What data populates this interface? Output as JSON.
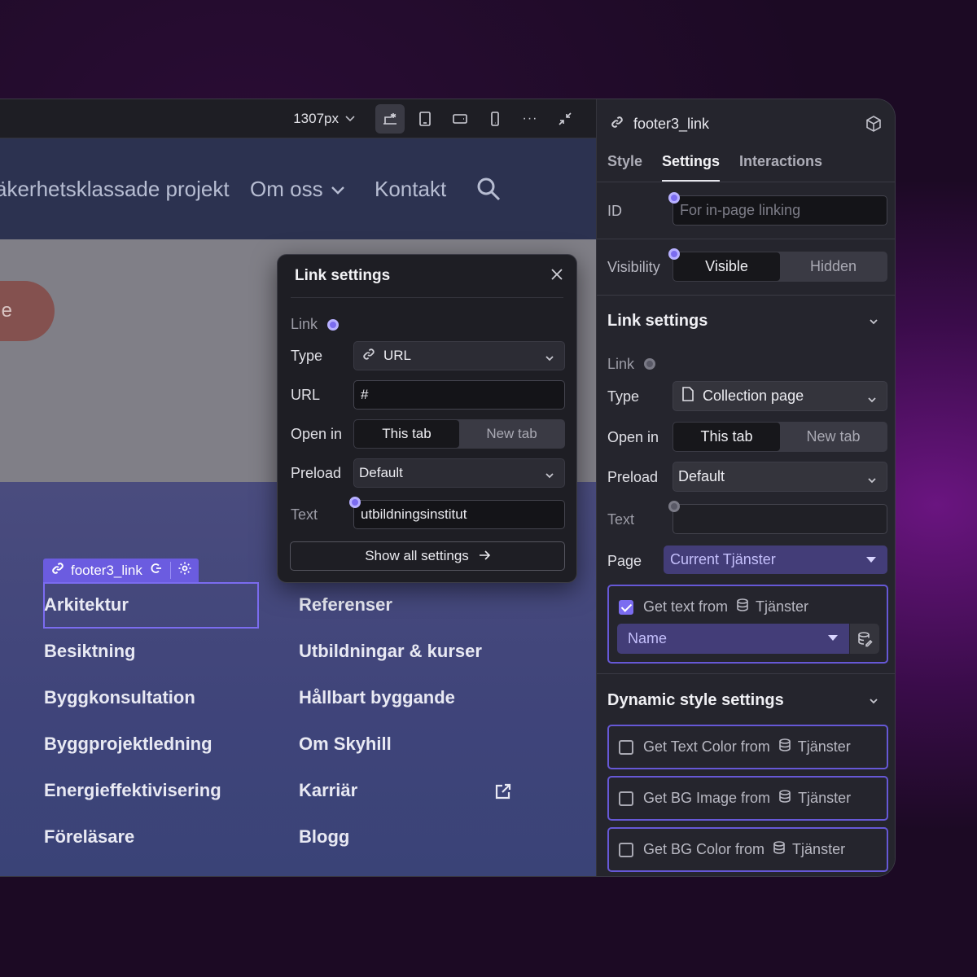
{
  "toolbar": {
    "width_label": "1307px",
    "more_label": "···"
  },
  "site": {
    "nav": [
      "äkerhetsklassade projekt",
      "Om oss",
      "Kontakt"
    ],
    "hero_button": "e",
    "footer_col1": [
      "Arkitektur",
      "Besiktning",
      "Byggkonsultation",
      "Byggprojektledning",
      "Energieffektivisering",
      "Föreläsare"
    ],
    "footer_col2": [
      "Referenser",
      "Utbildningar & kurser",
      "Hållbart byggande",
      "Om Skyhill",
      "Karriär",
      "Blogg"
    ],
    "selected_tag": "footer3_link"
  },
  "popup": {
    "title": "Link settings",
    "link_label": "Link",
    "type_label": "Type",
    "type_value": "URL",
    "url_label": "URL",
    "url_value": "#",
    "open_in_label": "Open in",
    "open_this": "This tab",
    "open_new": "New tab",
    "preload_label": "Preload",
    "preload_value": "Default",
    "text_label": "Text",
    "text_value": "utbildningsinstitut",
    "show_all": "Show all settings"
  },
  "panel": {
    "element_name": "footer3_link",
    "tabs": [
      "Style",
      "Settings",
      "Interactions"
    ],
    "active_tab": "Settings",
    "id_label": "ID",
    "id_placeholder": "For in-page linking",
    "visibility_label": "Visibility",
    "visible": "Visible",
    "hidden": "Hidden",
    "link_settings_title": "Link settings",
    "link_label": "Link",
    "type_label": "Type",
    "type_value": "Collection page",
    "open_in_label": "Open in",
    "open_this": "This tab",
    "open_new": "New tab",
    "preload_label": "Preload",
    "preload_value": "Default",
    "text_label": "Text",
    "page_label": "Page",
    "page_value": "Current Tjänster",
    "get_text_from": "Get text from",
    "collection": "Tjänster",
    "name_field": "Name",
    "dynamic_title": "Dynamic style settings",
    "dynamic_items": [
      "Get Text Color from",
      "Get BG Image from",
      "Get BG Color from"
    ]
  },
  "colors": {
    "accent": "#7b6cf0",
    "nav_bg": "#2c3250",
    "footer_bg": "#4a4c7e",
    "panel_bg": "#25252d"
  }
}
